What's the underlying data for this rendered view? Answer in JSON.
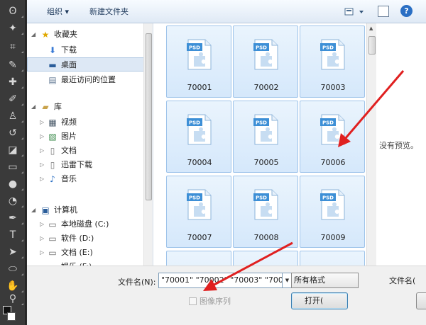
{
  "toolbar": {
    "organize_label": "组织 ▾",
    "new_folder_label": "新建文件夹",
    "help_label": "?"
  },
  "nav": {
    "favorites": "收藏夹",
    "downloads": "下载",
    "desktop": "桌面",
    "recent": "最近访问的位置",
    "libraries": "库",
    "videos": "视频",
    "pictures": "图片",
    "documents": "文档",
    "thunder": "迅雷下载",
    "music": "音乐",
    "computer": "计算机",
    "local_disk": "本地磁盘 (C:)",
    "software": "软件 (D:)",
    "docs_drive": "文档 (E:)",
    "partial": "娱乐 (F:)"
  },
  "files": [
    {
      "name": "70001",
      "badge": "PSD"
    },
    {
      "name": "70002",
      "badge": "PSD"
    },
    {
      "name": "70003",
      "badge": "PSD"
    },
    {
      "name": "70004",
      "badge": "PSD"
    },
    {
      "name": "70005",
      "badge": "PSD"
    },
    {
      "name": "70006",
      "badge": "PSD"
    },
    {
      "name": "70007",
      "badge": "PSD"
    },
    {
      "name": "70008",
      "badge": "PSD"
    },
    {
      "name": "70009",
      "badge": "PSD"
    }
  ],
  "preview": {
    "message": "没有预览。"
  },
  "bottom": {
    "filename_label": "文件名(N):",
    "filename_value": "\"70001\" \"70002\" \"70003\" \"7000",
    "format_value": "所有格式",
    "filename_label_right": "文件名(",
    "image_sequence_label": "图像序列",
    "open_label": "打开("
  },
  "colors": {
    "accent": "#e02020",
    "tile_border": "#9fc4ea",
    "psd_badge": "#3d8fd6"
  }
}
